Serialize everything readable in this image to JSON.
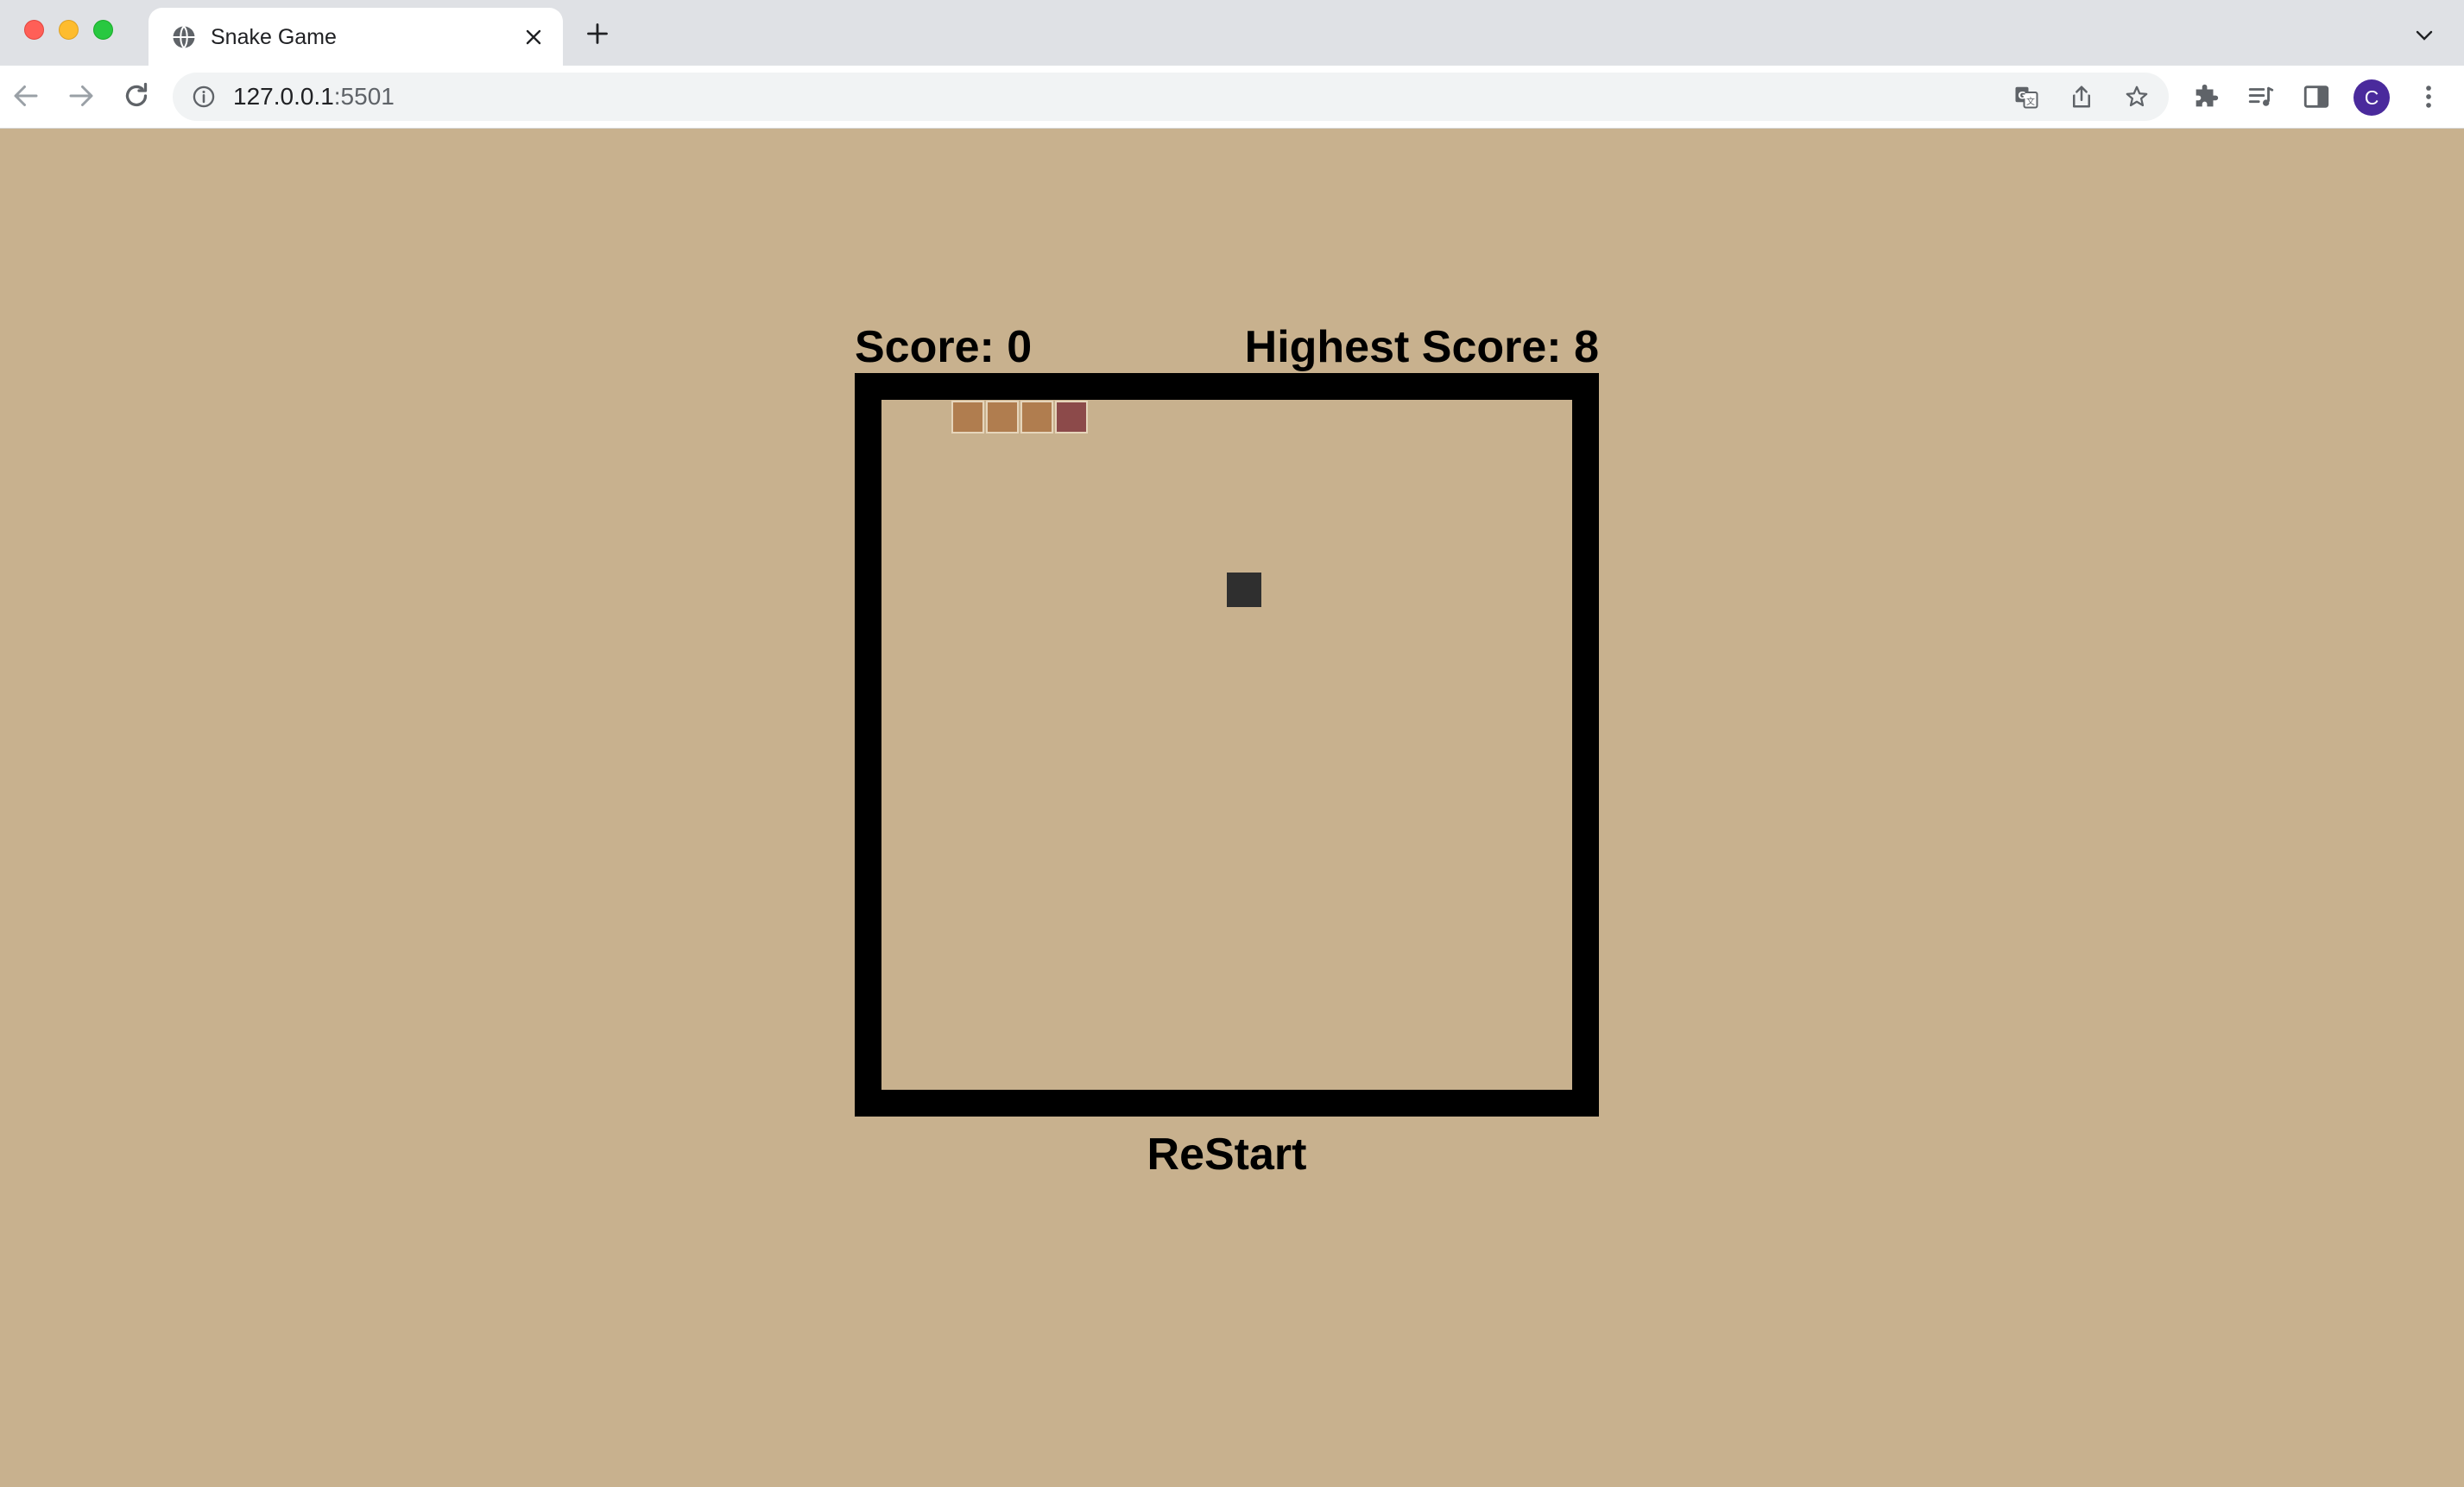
{
  "browser": {
    "tab_title": "Snake Game",
    "url_host": "127.0.0.1",
    "url_port": ":5501",
    "profile_initial": "C"
  },
  "game": {
    "score_label": "Score: 0",
    "highest_score_label": "Highest Score: 8",
    "score": 0,
    "highest_score": 8,
    "restart_label": "ReStart",
    "grid_size": 20,
    "snake": [
      {
        "col": 2,
        "row": 0,
        "part": "body"
      },
      {
        "col": 3,
        "row": 0,
        "part": "body"
      },
      {
        "col": 4,
        "row": 0,
        "part": "body"
      },
      {
        "col": 5,
        "row": 0,
        "part": "head"
      }
    ],
    "food": {
      "col": 10,
      "row": 5
    },
    "colors": {
      "background": "#c8b18e",
      "border": "#000000",
      "snake_body": "#b07d4f",
      "snake_head": "#8c4a4a",
      "food": "#2f2f2f"
    }
  }
}
